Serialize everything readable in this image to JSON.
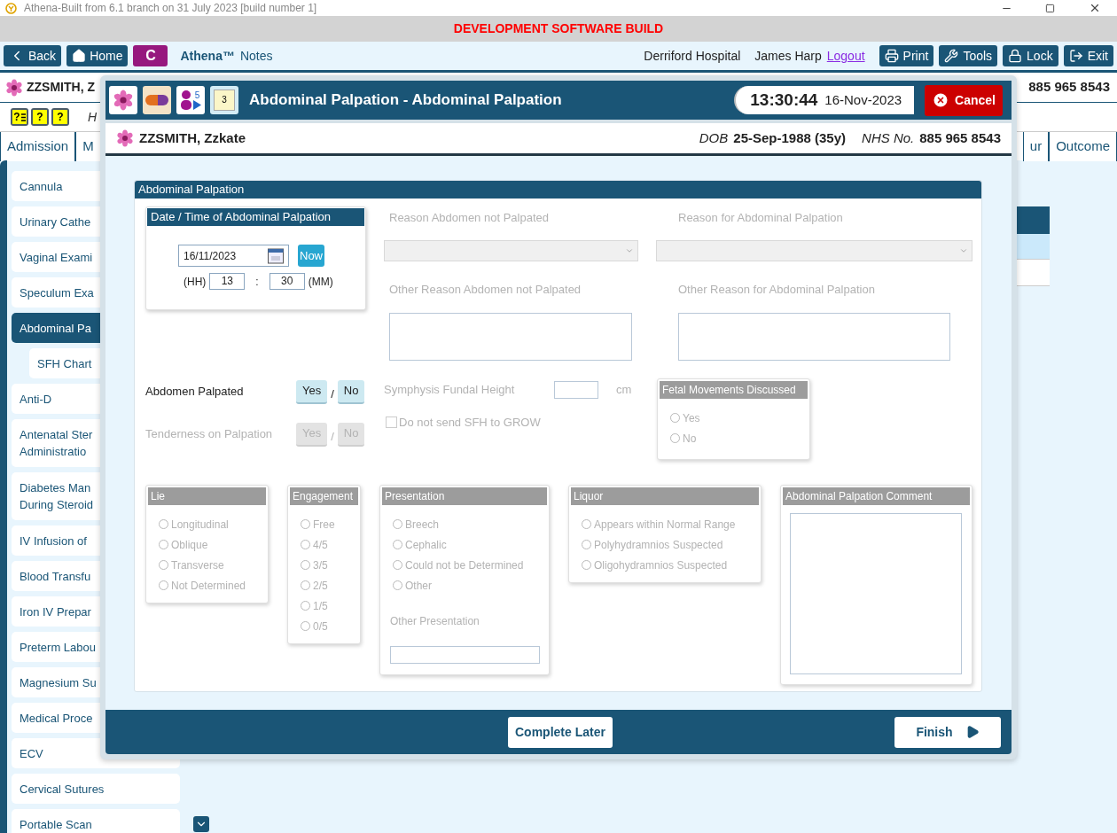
{
  "window": {
    "title": "Athena-Built from 6.1 branch on 31 July 2023 [build number 1]"
  },
  "banner": "DEVELOPMENT SOFTWARE BUILD",
  "toolbar": {
    "left_buttons": [
      {
        "label": "Back",
        "kind": "back"
      },
      {
        "label": "Home",
        "kind": "home"
      },
      {
        "label": "C",
        "kind": "letter"
      }
    ],
    "app_name": "Athena™",
    "app_section": "Notes",
    "location": "Derriford Hospital",
    "user": "James Harp",
    "logout": "Logout",
    "right_buttons": [
      {
        "label": "Print",
        "kind": "print"
      },
      {
        "label": "Tools",
        "kind": "tools"
      },
      {
        "label": "Lock",
        "kind": "lock"
      },
      {
        "label": "Exit",
        "kind": "exit"
      }
    ]
  },
  "patient_bar": {
    "name": "ZZSMITH, Z",
    "nhs_number": "885 965 8543"
  },
  "alert_row": {
    "icons": [
      {
        "kind": "list",
        "mark": "?"
      },
      {
        "kind": "plain",
        "mark": "?"
      },
      {
        "kind": "plain",
        "mark": "?"
      }
    ],
    "text": "H"
  },
  "tabs": [
    {
      "label": "Admission",
      "selected": false
    },
    {
      "label": "M",
      "selected": false
    },
    {
      "label": "ur",
      "selected": false
    },
    {
      "label": "Outcome",
      "selected": false
    }
  ],
  "sidebar": {
    "items": [
      {
        "lines": [
          "Cannula"
        ],
        "selected": false
      },
      {
        "lines": [
          "Urinary Cathe"
        ],
        "selected": false
      },
      {
        "lines": [
          "Vaginal Exami"
        ],
        "selected": false
      },
      {
        "lines": [
          "Speculum Exa"
        ],
        "selected": false
      },
      {
        "lines": [
          "Abdominal Pa"
        ],
        "selected": true,
        "children": [
          {
            "lines": [
              "SFH Chart"
            ],
            "selected": false
          }
        ]
      },
      {
        "lines": [
          "Anti-D"
        ],
        "selected": false
      },
      {
        "lines": [
          "Antenatal Ster",
          "Administratio"
        ],
        "selected": false
      },
      {
        "lines": [
          "Diabetes Man",
          "During Steroid"
        ],
        "selected": false
      },
      {
        "lines": [
          "IV Infusion of"
        ],
        "selected": false
      },
      {
        "lines": [
          "Blood Transfu"
        ],
        "selected": false
      },
      {
        "lines": [
          "Iron IV Prepar"
        ],
        "selected": false
      },
      {
        "lines": [
          "Preterm Labou"
        ],
        "selected": false
      },
      {
        "lines": [
          "Magnesium Su"
        ],
        "selected": false
      },
      {
        "lines": [
          "Medical Proce"
        ],
        "selected": false
      },
      {
        "lines": [
          "ECV"
        ],
        "selected": false
      },
      {
        "lines": [
          "Cervical Sutures"
        ],
        "selected": false
      },
      {
        "lines": [
          "Portable Scan"
        ],
        "selected": false
      }
    ]
  },
  "dialog": {
    "header_icons": [
      {
        "kind": "flower"
      },
      {
        "kind": "pill"
      },
      {
        "kind": "person",
        "count": "5"
      },
      {
        "kind": "notes",
        "count": "3"
      }
    ],
    "title": "Abdominal Palpation - Abdominal Palpation",
    "time": "13:30:44",
    "date": "16-Nov-2023",
    "cancel": "Cancel",
    "patient": {
      "name": "ZZSMITH, Zzkate",
      "dob_label": "DOB",
      "dob": "25-Sep-1988 (35y)",
      "nhs_label": "NHS No.",
      "nhs": "885 965 8543"
    },
    "panel": {
      "title": "Abdominal Palpation",
      "datetime": {
        "title": "Date / Time of Abdominal Palpation",
        "date": "16/11/2023",
        "now": "Now",
        "hh_label": "(HH)",
        "hh": "13",
        "sep": ":",
        "mm": "30",
        "mm_label": "(MM)"
      },
      "selects": [
        {
          "label": "Reason Abdomen not Palpated",
          "disabled": true
        },
        {
          "label": "Reason for Abdominal Palpation",
          "disabled": true
        }
      ],
      "other_reasons": [
        {
          "label": "Other Reason Abdomen not Palpated",
          "disabled": true
        },
        {
          "label": "Other Reason for Abdominal Palpation",
          "disabled": true
        }
      ],
      "toggles": [
        {
          "label": "Abdomen Palpated",
          "disabled": false,
          "options": [
            {
              "label": "Yes",
              "selected": false
            },
            {
              "label": "No",
              "selected": false
            }
          ],
          "separator": "/"
        },
        {
          "label": "Tenderness on Palpation",
          "disabled": true,
          "options": [
            {
              "label": "Yes",
              "selected": false
            },
            {
              "label": "No",
              "selected": false
            }
          ],
          "separator": "/"
        }
      ],
      "sfh": {
        "label": "Symphysis Fundal Height",
        "unit": "cm",
        "disabled": true
      },
      "grow_checkbox": {
        "label": "Do not send SFH to GROW",
        "checked": false,
        "disabled": true
      },
      "fetal_movements": {
        "title": "Fetal Movements Discussed",
        "disabled": true,
        "options": [
          {
            "label": "Yes",
            "selected": false
          },
          {
            "label": "No",
            "selected": false
          }
        ]
      },
      "groups": [
        {
          "title": "Lie",
          "disabled": true,
          "options": [
            {
              "label": "Longitudinal",
              "selected": false
            },
            {
              "label": "Oblique",
              "selected": false
            },
            {
              "label": "Transverse",
              "selected": false
            },
            {
              "label": "Not Determined",
              "selected": false
            }
          ]
        },
        {
          "title": "Engagement",
          "disabled": true,
          "options": [
            {
              "label": "Free",
              "selected": false
            },
            {
              "label": "4/5",
              "selected": false
            },
            {
              "label": "3/5",
              "selected": false
            },
            {
              "label": "2/5",
              "selected": false
            },
            {
              "label": "1/5",
              "selected": false
            },
            {
              "label": "0/5",
              "selected": false
            }
          ]
        },
        {
          "title": "Presentation",
          "disabled": true,
          "options": [
            {
              "label": "Breech",
              "selected": false
            },
            {
              "label": "Cephalic",
              "selected": false
            },
            {
              "label": "Could not be Determined",
              "selected": false
            },
            {
              "label": "Other",
              "selected": false
            }
          ],
          "other_label": "Other Presentation"
        },
        {
          "title": "Liquor",
          "disabled": true,
          "options": [
            {
              "label": "Appears within Normal Range",
              "selected": false
            },
            {
              "label": "Polyhydramnios Suspected",
              "selected": false
            },
            {
              "label": "Oligohydramnios Suspected",
              "selected": false
            }
          ]
        }
      ],
      "comment": {
        "title": "Abdominal Palpation Comment",
        "disabled": true
      }
    },
    "footer": {
      "complete_later": "Complete Later",
      "finish": "Finish"
    }
  }
}
